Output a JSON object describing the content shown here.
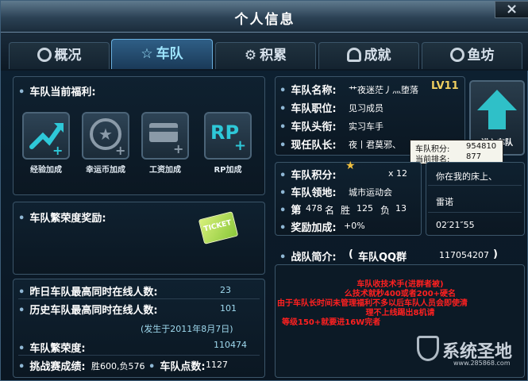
{
  "window": {
    "title": "个人信息",
    "close_label": "×"
  },
  "tabs": [
    {
      "label": "概况",
      "icon": "gauge-icon"
    },
    {
      "label": "车队",
      "icon": "star-icon",
      "active": true
    },
    {
      "label": "积累",
      "icon": "gear-icon"
    },
    {
      "label": "成就",
      "icon": "medal-icon"
    },
    {
      "label": "鱼坊",
      "icon": "fish-icon"
    }
  ],
  "benefits": {
    "heading": "车队当前福利:",
    "items": [
      {
        "label": "经验加成",
        "icon": "exp-up-icon"
      },
      {
        "label": "幸运币加成",
        "icon": "lucky-coin-icon"
      },
      {
        "label": "工资加成",
        "icon": "salary-card-icon"
      },
      {
        "label": "RP加成",
        "icon": "rp-plus-icon",
        "glyph": "RP"
      }
    ]
  },
  "honor_reward": {
    "heading": "车队繁荣度奖励:",
    "icon": "reward-ticket-icon",
    "ticket_text": "TICKET"
  },
  "team_stats": {
    "rows": [
      {
        "label": "昨日车队最高同时在线人数:",
        "value": "23"
      },
      {
        "label": "历史车队最高同时在线人数:",
        "value": "101"
      }
    ],
    "history_date": "(发生于2011年8月7日)",
    "prosperity_label": "车队繁荣度:",
    "prosperity_value": "110474",
    "challenge_label": "挑战赛成绩:",
    "challenge_value": "胜600,负576",
    "points_label": "车队点数:",
    "points_value": "1127"
  },
  "team_info": {
    "name_label": "车队名称:",
    "name_value": "艹夜迷茫丿灬堕落",
    "level": "LV11",
    "position_label": "车队职位:",
    "position_value": "见习成员",
    "title_label": "车队头衔:",
    "title_value": "实习车手",
    "leader_label": "现任队长:",
    "leader_value": "夜丨君莫邪、"
  },
  "upgrade": {
    "label": "进入车队",
    "icon": "up-arrow-icon"
  },
  "tooltip": {
    "score_label": "车队积分:",
    "score_value": "954810",
    "rank_label": "当前排名:",
    "rank_value": "877"
  },
  "team_score": {
    "score_label": "车队积分:",
    "score_icon": "gold-star-icon",
    "score_multiplier": "x 12",
    "territory_label": "车队领地:",
    "territory_value": "城市运动会",
    "rank_prefix": "第",
    "rank_value": "478",
    "rank_unit": "名",
    "win_label": "胜",
    "win_value": "125",
    "loss_label": "负",
    "loss_value": "13",
    "bonus_label": "奖励加成:",
    "bonus_value": "+0%"
  },
  "right_list": {
    "row1": "你在我的床上、",
    "row2": "雷诺",
    "row3": "02′21″55"
  },
  "intro": {
    "label": "战队简介:",
    "paren_open": "(",
    "group_label": "车队QQ群",
    "qq": "117054207",
    "paren_close": ")",
    "lines": [
      "车队收技术手(进群者被)",
      "么技术就秒400或者200+硬名",
      "由于车队长时间未管理福利不多以后车队人员会即使清",
      "理不上线踢出8机请",
      "等级150+就要进16W完者"
    ]
  },
  "watermark": {
    "name": "系统圣地",
    "url": "www.285868.com"
  },
  "colors": {
    "accent": "#59c8f0",
    "intro_text": "#ff2020",
    "tab_active": "#9ee6ff",
    "upgrade_arrow": "#2fc0c8"
  }
}
